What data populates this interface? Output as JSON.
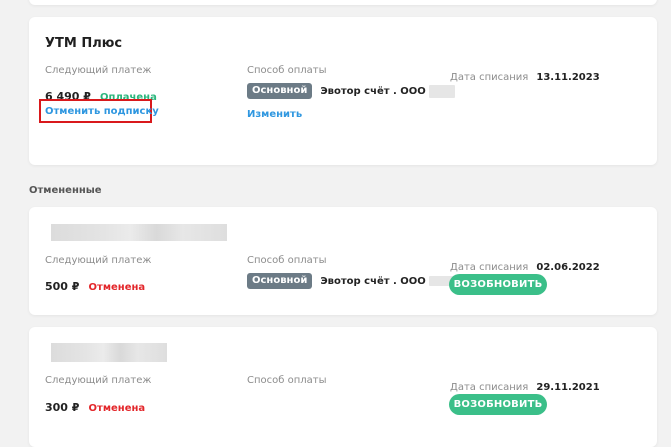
{
  "colors": {
    "paid": "#2bb67d",
    "cancelled": "#e3262a",
    "link": "#2f97e0",
    "badge": "#6c7b86",
    "renew": "#3bbf89",
    "highlight": "#d9191c"
  },
  "active": {
    "title": "УТМ Плюс",
    "next_payment_label": "Следующий платеж",
    "amount": "6 490 ₽",
    "status": "Оплачена",
    "cancel_link": "Отменить подписку",
    "payment_method_label": "Способ оплаты",
    "badge": "Основной",
    "account": "Эвотор счёт . ООО",
    "change_link": "Изменить",
    "charge_date_label": "Дата списания",
    "charge_date": "13.11.2023"
  },
  "cancelled_section_label": "Отмененные",
  "cancelled": [
    {
      "next_payment_label": "Следующий платеж",
      "amount": "500 ₽",
      "status": "Отменена",
      "payment_method_label": "Способ оплаты",
      "badge": "Основной",
      "account": "Эвотор счёт . ООО",
      "charge_date_label": "Дата списания",
      "charge_date": "02.06.2022",
      "renew_button": "ВОЗОБНОВИТЬ"
    },
    {
      "next_payment_label": "Следующий платеж",
      "amount": "300 ₽",
      "status": "Отменена",
      "payment_method_label": "Способ оплаты",
      "charge_date_label": "Дата списания",
      "charge_date": "29.11.2021",
      "renew_button": "ВОЗОБНОВИТЬ"
    }
  ]
}
